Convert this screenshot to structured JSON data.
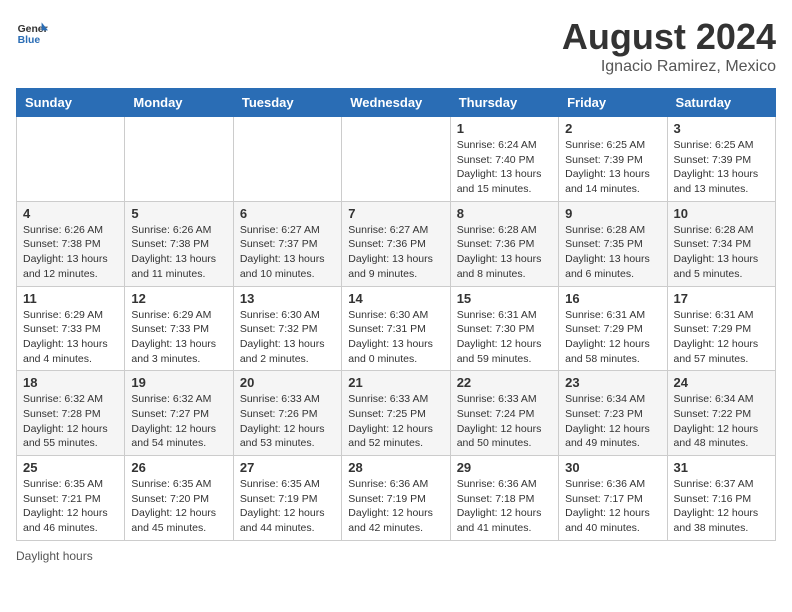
{
  "header": {
    "logo_general": "General",
    "logo_blue": "Blue",
    "title": "August 2024",
    "subtitle": "Ignacio Ramirez, Mexico"
  },
  "calendar": {
    "days_of_week": [
      "Sunday",
      "Monday",
      "Tuesday",
      "Wednesday",
      "Thursday",
      "Friday",
      "Saturday"
    ],
    "weeks": [
      [
        {
          "day": "",
          "info": ""
        },
        {
          "day": "",
          "info": ""
        },
        {
          "day": "",
          "info": ""
        },
        {
          "day": "",
          "info": ""
        },
        {
          "day": "1",
          "info": "Sunrise: 6:24 AM\nSunset: 7:40 PM\nDaylight: 13 hours\nand 15 minutes."
        },
        {
          "day": "2",
          "info": "Sunrise: 6:25 AM\nSunset: 7:39 PM\nDaylight: 13 hours\nand 14 minutes."
        },
        {
          "day": "3",
          "info": "Sunrise: 6:25 AM\nSunset: 7:39 PM\nDaylight: 13 hours\nand 13 minutes."
        }
      ],
      [
        {
          "day": "4",
          "info": "Sunrise: 6:26 AM\nSunset: 7:38 PM\nDaylight: 13 hours\nand 12 minutes."
        },
        {
          "day": "5",
          "info": "Sunrise: 6:26 AM\nSunset: 7:38 PM\nDaylight: 13 hours\nand 11 minutes."
        },
        {
          "day": "6",
          "info": "Sunrise: 6:27 AM\nSunset: 7:37 PM\nDaylight: 13 hours\nand 10 minutes."
        },
        {
          "day": "7",
          "info": "Sunrise: 6:27 AM\nSunset: 7:36 PM\nDaylight: 13 hours\nand 9 minutes."
        },
        {
          "day": "8",
          "info": "Sunrise: 6:28 AM\nSunset: 7:36 PM\nDaylight: 13 hours\nand 8 minutes."
        },
        {
          "day": "9",
          "info": "Sunrise: 6:28 AM\nSunset: 7:35 PM\nDaylight: 13 hours\nand 6 minutes."
        },
        {
          "day": "10",
          "info": "Sunrise: 6:28 AM\nSunset: 7:34 PM\nDaylight: 13 hours\nand 5 minutes."
        }
      ],
      [
        {
          "day": "11",
          "info": "Sunrise: 6:29 AM\nSunset: 7:33 PM\nDaylight: 13 hours\nand 4 minutes."
        },
        {
          "day": "12",
          "info": "Sunrise: 6:29 AM\nSunset: 7:33 PM\nDaylight: 13 hours\nand 3 minutes."
        },
        {
          "day": "13",
          "info": "Sunrise: 6:30 AM\nSunset: 7:32 PM\nDaylight: 13 hours\nand 2 minutes."
        },
        {
          "day": "14",
          "info": "Sunrise: 6:30 AM\nSunset: 7:31 PM\nDaylight: 13 hours\nand 0 minutes."
        },
        {
          "day": "15",
          "info": "Sunrise: 6:31 AM\nSunset: 7:30 PM\nDaylight: 12 hours\nand 59 minutes."
        },
        {
          "day": "16",
          "info": "Sunrise: 6:31 AM\nSunset: 7:29 PM\nDaylight: 12 hours\nand 58 minutes."
        },
        {
          "day": "17",
          "info": "Sunrise: 6:31 AM\nSunset: 7:29 PM\nDaylight: 12 hours\nand 57 minutes."
        }
      ],
      [
        {
          "day": "18",
          "info": "Sunrise: 6:32 AM\nSunset: 7:28 PM\nDaylight: 12 hours\nand 55 minutes."
        },
        {
          "day": "19",
          "info": "Sunrise: 6:32 AM\nSunset: 7:27 PM\nDaylight: 12 hours\nand 54 minutes."
        },
        {
          "day": "20",
          "info": "Sunrise: 6:33 AM\nSunset: 7:26 PM\nDaylight: 12 hours\nand 53 minutes."
        },
        {
          "day": "21",
          "info": "Sunrise: 6:33 AM\nSunset: 7:25 PM\nDaylight: 12 hours\nand 52 minutes."
        },
        {
          "day": "22",
          "info": "Sunrise: 6:33 AM\nSunset: 7:24 PM\nDaylight: 12 hours\nand 50 minutes."
        },
        {
          "day": "23",
          "info": "Sunrise: 6:34 AM\nSunset: 7:23 PM\nDaylight: 12 hours\nand 49 minutes."
        },
        {
          "day": "24",
          "info": "Sunrise: 6:34 AM\nSunset: 7:22 PM\nDaylight: 12 hours\nand 48 minutes."
        }
      ],
      [
        {
          "day": "25",
          "info": "Sunrise: 6:35 AM\nSunset: 7:21 PM\nDaylight: 12 hours\nand 46 minutes."
        },
        {
          "day": "26",
          "info": "Sunrise: 6:35 AM\nSunset: 7:20 PM\nDaylight: 12 hours\nand 45 minutes."
        },
        {
          "day": "27",
          "info": "Sunrise: 6:35 AM\nSunset: 7:19 PM\nDaylight: 12 hours\nand 44 minutes."
        },
        {
          "day": "28",
          "info": "Sunrise: 6:36 AM\nSunset: 7:19 PM\nDaylight: 12 hours\nand 42 minutes."
        },
        {
          "day": "29",
          "info": "Sunrise: 6:36 AM\nSunset: 7:18 PM\nDaylight: 12 hours\nand 41 minutes."
        },
        {
          "day": "30",
          "info": "Sunrise: 6:36 AM\nSunset: 7:17 PM\nDaylight: 12 hours\nand 40 minutes."
        },
        {
          "day": "31",
          "info": "Sunrise: 6:37 AM\nSunset: 7:16 PM\nDaylight: 12 hours\nand 38 minutes."
        }
      ]
    ],
    "footer_note": "Daylight hours"
  }
}
